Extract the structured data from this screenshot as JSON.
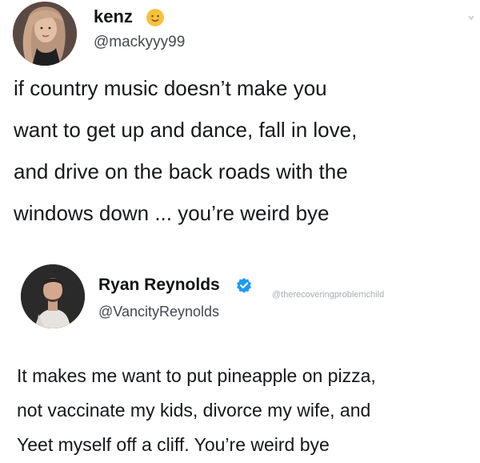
{
  "tweets": [
    {
      "author": {
        "name": "kenz",
        "handle": "@mackyyy99",
        "name_emoji": "smiling-face-emoji"
      },
      "text": "if country music doesn’t make you\nwant to get up and dance, fall in love,\nand drive on the back roads with the\nwindows down ... you’re weird bye"
    },
    {
      "author": {
        "name": "Ryan Reynolds",
        "handle": "@VancityReynolds",
        "verified": true
      },
      "watermark": "@therecoveringproblemchild",
      "text": "It makes me want to put pineapple on pizza,\nnot vaccinate my kids, divorce  my wife, and\nYeet myself off a cliff. You’re weird bye"
    }
  ],
  "colors": {
    "text": "#16181a",
    "handle": "#44484c",
    "verified_badge": "#1d9bf0",
    "emoji": "#f5c33b",
    "watermark": "#a9aeb3"
  }
}
